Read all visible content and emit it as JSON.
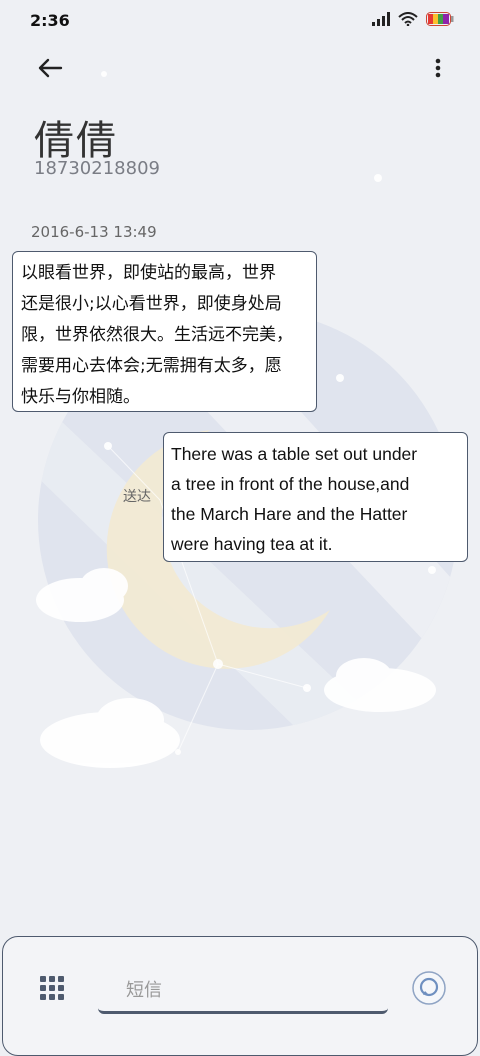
{
  "status_bar": {
    "time": "2:36"
  },
  "header": {
    "back_icon": "arrow-left-icon",
    "more_icon": "more-vert-icon",
    "contact_name": "倩倩",
    "contact_number": "18730218809"
  },
  "conversation": {
    "timestamp": "2016-6-13 13:49",
    "incoming_message": {
      "lines": [
        "以眼看世界，即使站的最高，世界",
        "还是很小;以心看世界，即使身处局",
        "限，世界依然很大。生活远不完美，",
        "需要用心去体会;无需拥有太多，愿",
        "快乐与你相随。"
      ]
    },
    "outgoing_message": {
      "lines": [
        "There was a table set out under",
        "a tree in front of the house,and",
        "the March Hare and the Hatter",
        "were having tea at it."
      ],
      "status": "送达"
    }
  },
  "composer": {
    "placeholder": "短信",
    "apps_icon": "grid-apps-icon",
    "send_icon": "send-bubble-icon"
  },
  "colors": {
    "accent": "#4e5a6e",
    "background": "#eef0f4",
    "moon": "#f6ecd0"
  }
}
